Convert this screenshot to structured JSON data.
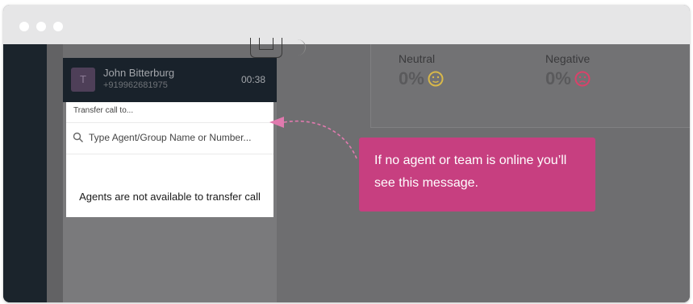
{
  "stats": {
    "neutral": {
      "label": "Neutral",
      "value": "0%"
    },
    "negative": {
      "label": "Negative",
      "value": "0%"
    }
  },
  "call": {
    "avatar_initial": "T",
    "caller_name": "John Bitterburg",
    "caller_number": "+919962681975",
    "timer": "00:38"
  },
  "transfer": {
    "title": "Transfer call to...",
    "search_placeholder": "Type Agent/Group Name or Number...",
    "unavailable_message": "Agents are not available to transfer call"
  },
  "callout": {
    "text": "If no agent or team is online you’ll  see this message."
  },
  "colors": {
    "callout_pink": "#c73f80",
    "header_dark": "#19222b",
    "emoji_neutral": "#e6c84a",
    "emoji_negative": "#e04a6a"
  }
}
